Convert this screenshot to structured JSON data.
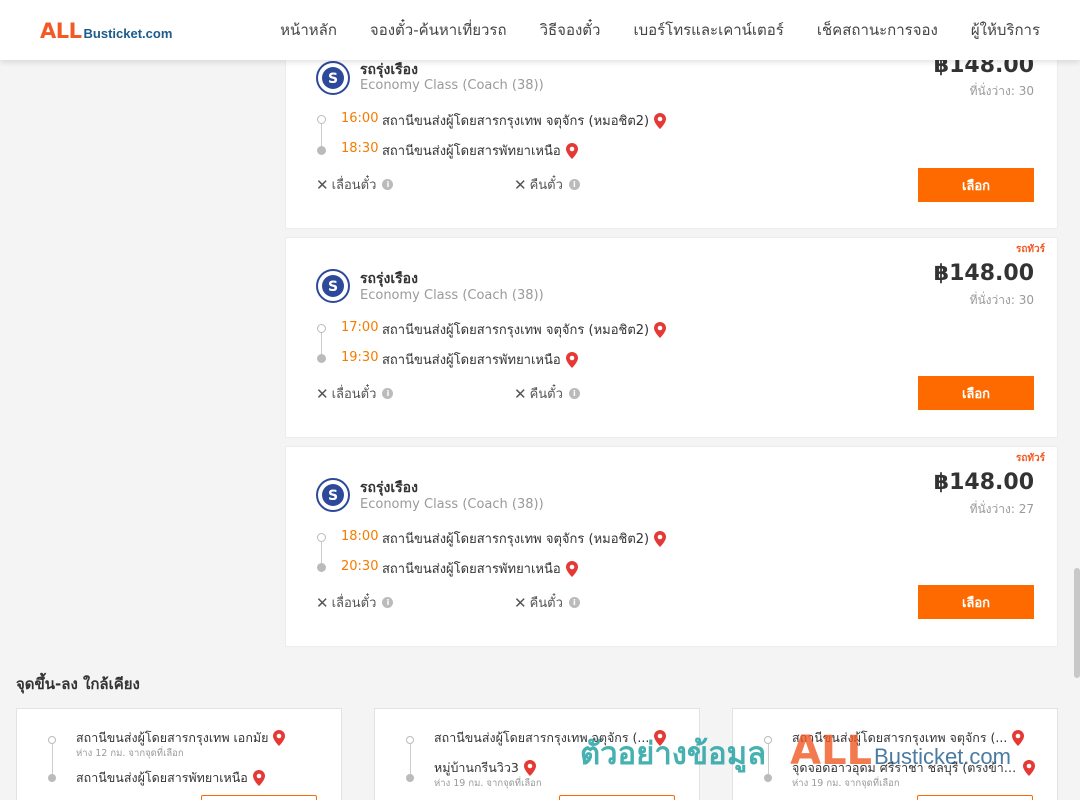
{
  "header": {
    "logo_all": "ALL",
    "logo_rest": "Busticket.com",
    "nav": [
      "หน้าหลัก",
      "จองตั๋ว-ค้นหาเที่ยวรถ",
      "วิธีจองตั๋ว",
      "เบอร์โทรและเคาน์เตอร์",
      "เช็คสถานะการจอง",
      "ผู้ให้บริการ"
    ]
  },
  "trips": [
    {
      "tag": "",
      "operator": "รถรุ่งเรือง",
      "bus_class": "Economy Class (Coach (38))",
      "price": "฿148.00",
      "seats": "ที่นั่งว่าง: 30",
      "depart_time": "16:00",
      "depart_station": "สถานีขนส่งผู้โดยสารกรุงเทพ จตุจักร (หมอชิต2)",
      "arrive_time": "18:30",
      "arrive_station": "สถานีขนส่งผู้โดยสารพัทยาเหนือ",
      "policy_change": "เลื่อนตั๋ว",
      "policy_refund": "คืนตั๋ว",
      "select_label": "เลือก"
    },
    {
      "tag": "รถทัวร์",
      "operator": "รถรุ่งเรือง",
      "bus_class": "Economy Class (Coach (38))",
      "price": "฿148.00",
      "seats": "ที่นั่งว่าง: 30",
      "depart_time": "17:00",
      "depart_station": "สถานีขนส่งผู้โดยสารกรุงเทพ จตุจักร (หมอชิต2)",
      "arrive_time": "19:30",
      "arrive_station": "สถานีขนส่งผู้โดยสารพัทยาเหนือ",
      "policy_change": "เลื่อนตั๋ว",
      "policy_refund": "คืนตั๋ว",
      "select_label": "เลือก"
    },
    {
      "tag": "รถทัวร์",
      "operator": "รถรุ่งเรือง",
      "bus_class": "Economy Class (Coach (38))",
      "price": "฿148.00",
      "seats": "ที่นั่งว่าง: 27",
      "depart_time": "18:00",
      "depart_station": "สถานีขนส่งผู้โดยสารกรุงเทพ จตุจักร (หมอชิต2)",
      "arrive_time": "20:30",
      "arrive_station": "สถานีขนส่งผู้โดยสารพัทยาเหนือ",
      "policy_change": "เลื่อนตั๋ว",
      "policy_refund": "คืนตั๋ว",
      "select_label": "เลือก"
    }
  ],
  "nearby": {
    "title": "จุดขึ้น-ลง ใกล้เคียง",
    "items": [
      {
        "from": "สถานีขนส่งผู้โดยสารกรุงเทพ เอกมัย",
        "from_dist": "ห่าง 12 กม. จากจุดที่เลือก",
        "to": "สถานีขนส่งผู้โดยสารพัทยาเหนือ",
        "to_dist": ""
      },
      {
        "from": "สถานีขนส่งผู้โดยสารกรุงเทพ จตุจักร (...",
        "from_dist": "",
        "to": "หมู่บ้านกรีนวิว3",
        "to_dist": "ห่าง 19 กม. จากจุดที่เลือก"
      },
      {
        "from": "สถานีขนส่งผู้โดยสารกรุงเทพ จตุจักร (...",
        "from_dist": "",
        "to": "จุดจอดอาวอุดม ศรีราชา ชลบุรี (ตรงข้าม...",
        "to_dist": "ห่าง 19 กม. จากจุดที่เลือก"
      }
    ]
  },
  "watermark": {
    "thai": "ตัวอย่างข้อมูล",
    "all": "ALL",
    "rest": "Busticket.com"
  },
  "colors": {
    "brand_orange": "#ff6a00",
    "time_orange": "#f57c00",
    "logo_blue": "#1d5b8c",
    "pin_red": "#e53935"
  }
}
